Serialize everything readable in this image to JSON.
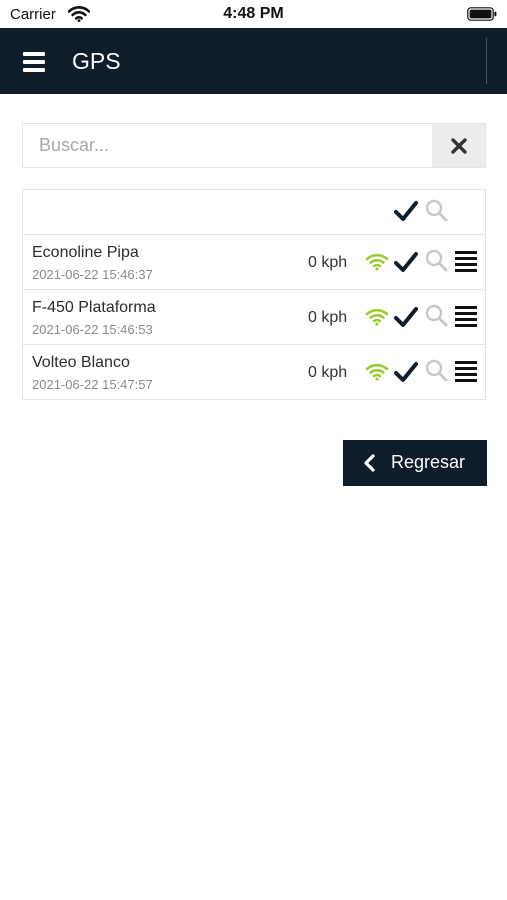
{
  "status_bar": {
    "carrier": "Carrier",
    "time": "4:48 PM"
  },
  "header": {
    "title": "GPS",
    "menu_icon": "hamburger-menu-icon"
  },
  "search": {
    "placeholder": "Buscar...",
    "value": "",
    "clear_icon": "close-icon"
  },
  "table": {
    "header_icons": [
      "check-icon",
      "search-icon"
    ],
    "rows": [
      {
        "name": "Econoline Pipa",
        "timestamp": "2021-06-22 15:46:37",
        "speed": "0 kph"
      },
      {
        "name": "F-450 Plataforma",
        "timestamp": "2021-06-22 15:46:53",
        "speed": "0 kph"
      },
      {
        "name": "Volteo Blanco",
        "timestamp": "2021-06-22 15:47:57",
        "speed": "0 kph"
      }
    ]
  },
  "back_button": {
    "label": "Regresar"
  },
  "colors": {
    "header_bg": "#0f1c2a",
    "signal_green": "#9acd32",
    "check_dark": "#0f1c2a",
    "muted_icon": "#c8c8c8"
  }
}
